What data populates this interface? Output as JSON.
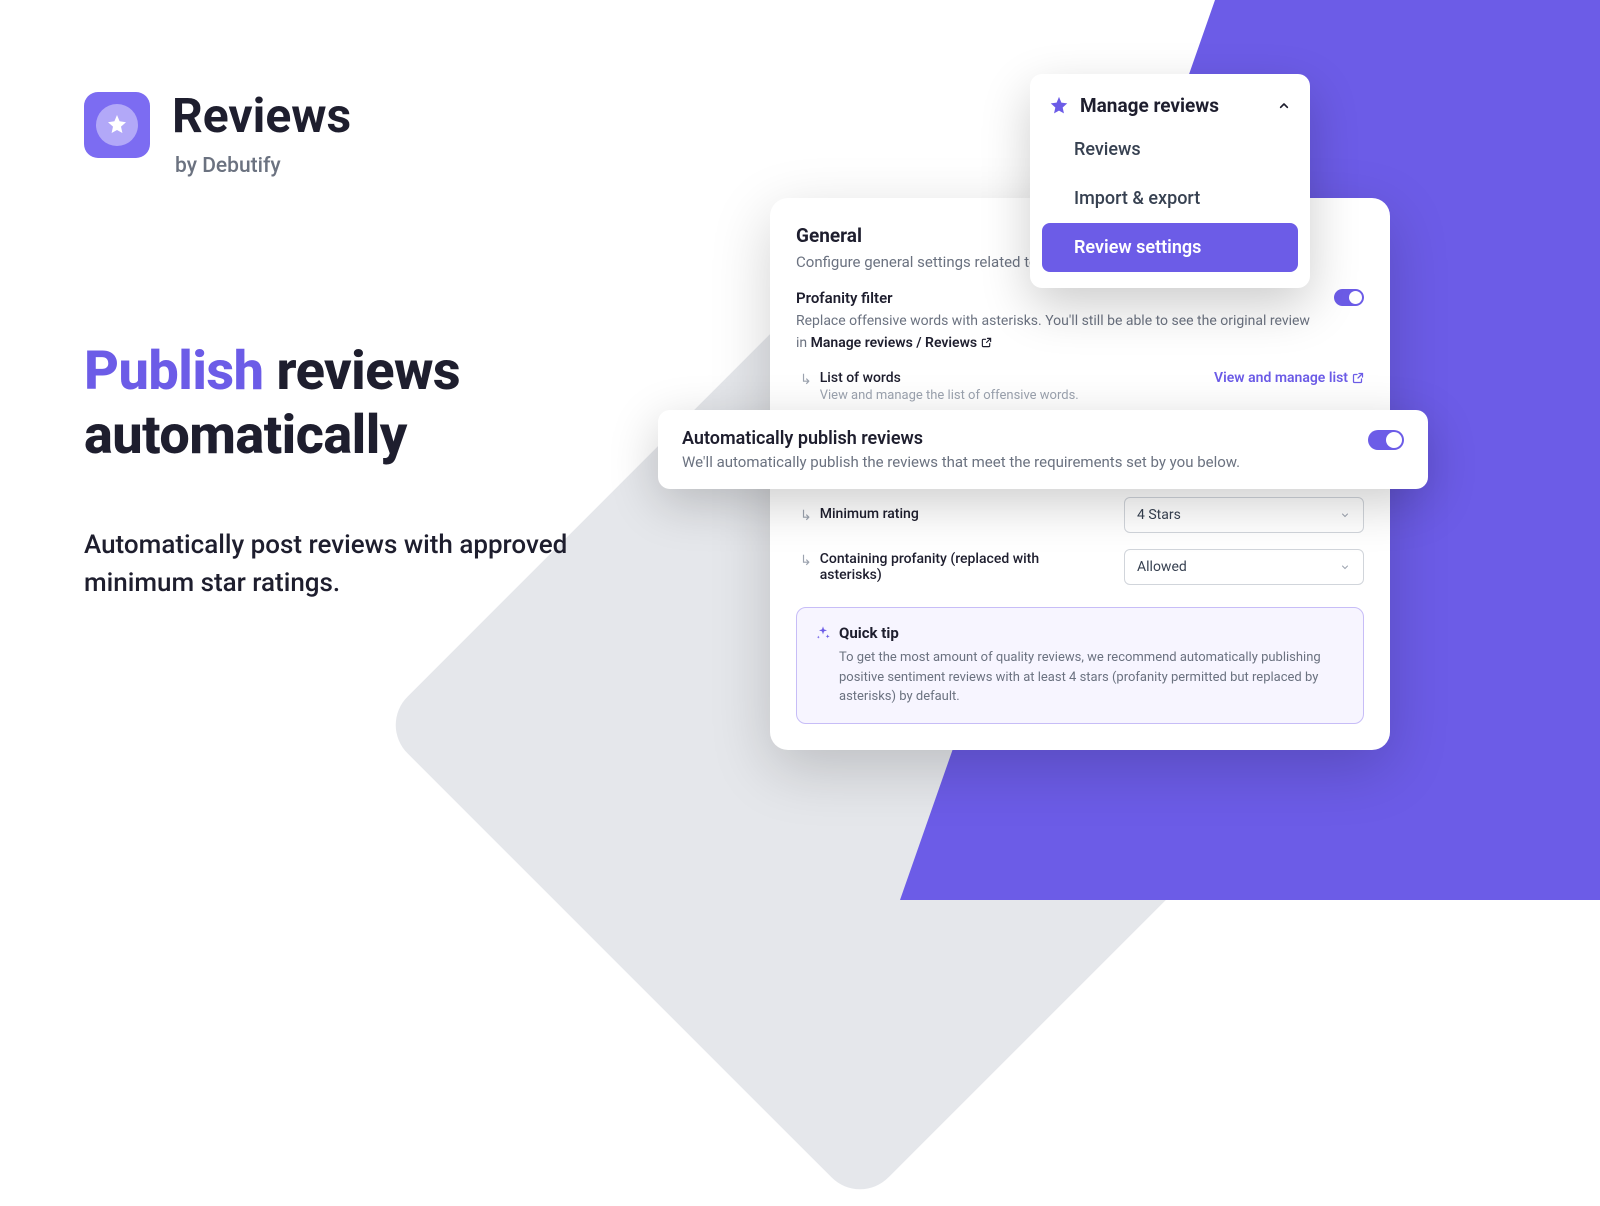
{
  "logo": {
    "title": "Reviews",
    "subtitle": "by Debutify"
  },
  "hero": {
    "accent": "Publish",
    "rest1": "reviews",
    "rest2": "automatically",
    "sub": "Automatically post reviews with approved minimum star ratings."
  },
  "menu": {
    "title": "Manage reviews",
    "items": [
      "Reviews",
      "Import & export",
      "Review settings"
    ]
  },
  "settings": {
    "section_title": "General",
    "section_desc": "Configure general settings related to reviews.",
    "profanity": {
      "label": "Profanity filter",
      "desc_prefix": "Replace offensive words with asterisks. You'll still be able to see the original review in ",
      "link": "Manage reviews / Reviews"
    },
    "words": {
      "title": "List of words",
      "desc": "View and manage the list of offensive words.",
      "action": "View and manage list"
    },
    "min_rating": {
      "label": "Minimum rating",
      "value": "4 Stars"
    },
    "containing": {
      "label": "Containing profanity (replaced with asterisks)",
      "value": "Allowed"
    },
    "tip": {
      "title": "Quick tip",
      "body": "To get the most amount of quality reviews, we recommend automatically publishing positive sentiment reviews with at least 4 stars (profanity permitted but replaced by asterisks) by default."
    }
  },
  "floating": {
    "title": "Automatically publish reviews",
    "desc": "We'll automatically publish the reviews that meet the requirements set by you below."
  },
  "colors": {
    "accent": "#6c5ce7"
  }
}
